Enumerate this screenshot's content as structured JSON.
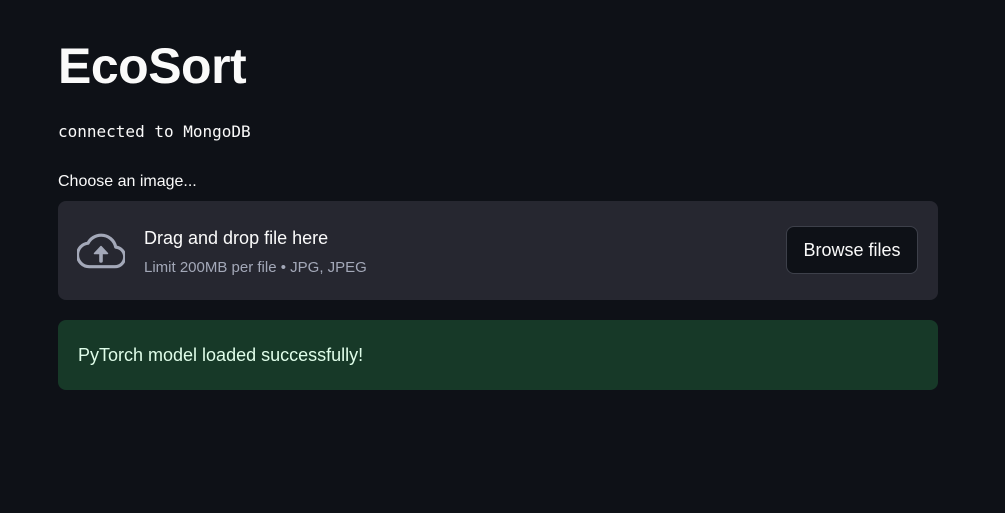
{
  "header": {
    "title": "EcoSort"
  },
  "status": {
    "connection_text": "connected to MongoDB"
  },
  "uploader": {
    "label": "Choose an image...",
    "drop_title": "Drag and drop file here",
    "drop_hint": "Limit 200MB per file • JPG, JPEG",
    "browse_label": "Browse files",
    "icon": "cloud-upload-icon"
  },
  "alert": {
    "type": "success",
    "message": "PyTorch model loaded successfully!"
  },
  "colors": {
    "background": "#0e1117",
    "dropzone": "#262730",
    "success_bg": "#173928",
    "success_text": "#dffde9",
    "muted_text": "#a3a8b8"
  }
}
